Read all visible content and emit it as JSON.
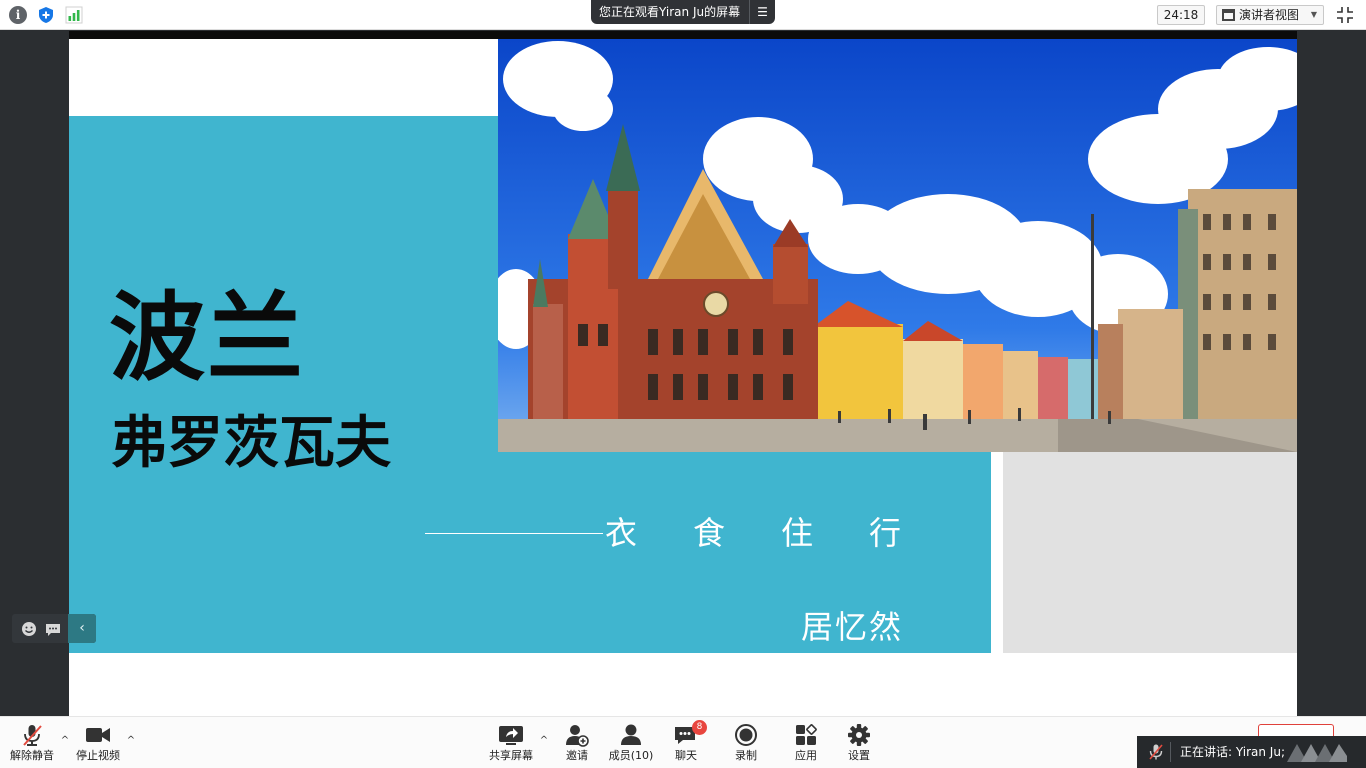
{
  "topbar": {
    "banner_text": "您正在观看Yiran Ju的屏幕",
    "banner_menu_icon": "menu-lines-icon",
    "timer": "24:18",
    "view_label": "演讲者视图",
    "icons": [
      "info-icon",
      "shield-icon",
      "signal-icon",
      "fullscreen-exit-icon"
    ]
  },
  "slide": {
    "title": "波兰",
    "subtitle": "弗罗茨瓦夫",
    "motto": "衣食住行",
    "author": "居忆然",
    "colors": {
      "teal": "#40b5cf",
      "grey": "#e1e1e1",
      "text": "#0a0a0a"
    }
  },
  "toolbar": {
    "unmute_label": "解除静音",
    "stop_video_label": "停止视频",
    "share_label": "共享屏幕",
    "invite_label": "邀请",
    "participants_label": "成员(10)",
    "chat_label": "聊天",
    "chat_badge": "8",
    "record_label": "录制",
    "apps_label": "应用",
    "settings_label": "设置"
  },
  "speaker": {
    "text": "正在讲话: Yiran Ju;"
  },
  "accent_colors": {
    "badge": "#e8463f",
    "panel_collapse": "#2d7984",
    "end_button_border": "#e0413b"
  }
}
